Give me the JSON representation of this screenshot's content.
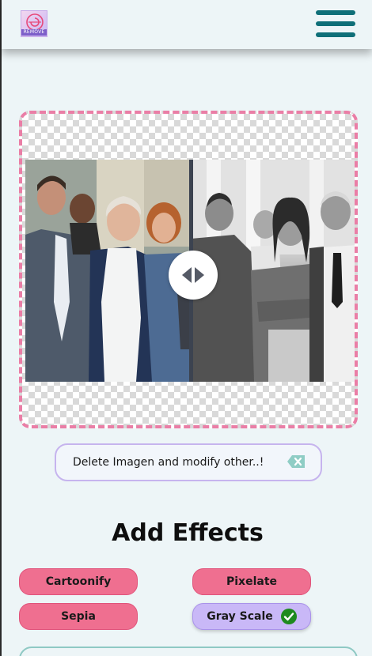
{
  "header": {
    "logo_text": "REMOVE",
    "menu_icon": "hamburger-menu-icon",
    "accent": "#0f6f78"
  },
  "preview": {
    "compare_icon": "compare-arrows-icon",
    "border_color": "#ea7ea6"
  },
  "delete_box": {
    "text": "Delete Imagen and modify other..!",
    "icon": "backspace-x-icon"
  },
  "effects": {
    "title": "Add Effects",
    "buttons": [
      {
        "label": "Cartoonify",
        "active": false
      },
      {
        "label": "Pixelate",
        "active": false
      },
      {
        "label": "Sepia",
        "active": false
      },
      {
        "label": "Gray Scale",
        "active": true
      }
    ],
    "check_icon": "check-circle-icon",
    "button_color": "#ef6f90",
    "active_color": "#c9b8f7"
  }
}
